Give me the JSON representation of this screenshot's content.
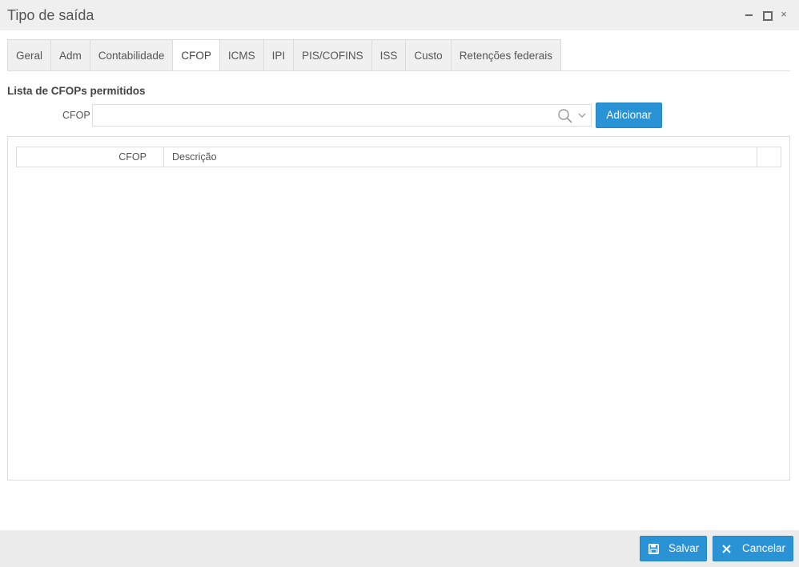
{
  "window": {
    "title": "Tipo de saída",
    "controls": [
      "minimize",
      "maximize",
      "close"
    ],
    "close_glyph": "×"
  },
  "tabs": [
    {
      "label": "Geral",
      "active": false
    },
    {
      "label": "Adm",
      "active": false
    },
    {
      "label": "Contabilidade",
      "active": false
    },
    {
      "label": "CFOP",
      "active": true
    },
    {
      "label": "ICMS",
      "active": false
    },
    {
      "label": "IPI",
      "active": false
    },
    {
      "label": "PIS/COFINS",
      "active": false
    },
    {
      "label": "ISS",
      "active": false
    },
    {
      "label": "Custo",
      "active": false
    },
    {
      "label": "Retenções federais",
      "active": false
    }
  ],
  "cfop_section": {
    "title": "Lista de CFOPs permitidos",
    "field_label": "CFOP",
    "field_value": "",
    "add_button": "Adicionar"
  },
  "grid": {
    "columns": [
      "CFOP",
      "Descrição"
    ],
    "rows": []
  },
  "footer": {
    "save_label": "Salvar",
    "cancel_label": "Cancelar"
  },
  "colors": {
    "accent": "#2a93d5",
    "titlebar_bg": "#efefef",
    "border": "#dcdcdc"
  },
  "icons": {
    "search": "search-icon",
    "dropdown": "chevron-down-icon",
    "save": "floppy-disk-icon",
    "cancel": "close-icon"
  }
}
